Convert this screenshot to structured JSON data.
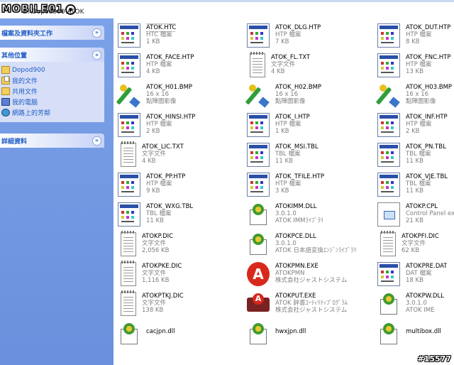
{
  "top": {
    "logo": "MOBILE01",
    "address": "D:\\Dopod900\\ATOK"
  },
  "panels": {
    "tasks": {
      "title": "檔案及資料夾工作"
    },
    "places": {
      "title": "其他位置",
      "items": [
        {
          "label": "Dopod900",
          "icon": "folder-icon"
        },
        {
          "label": "我的文件",
          "icon": "my-documents-icon"
        },
        {
          "label": "共用文件",
          "icon": "folder-icon"
        },
        {
          "label": "我的電腦",
          "icon": "my-computer-icon"
        },
        {
          "label": "網路上的芳鄰",
          "icon": "network-icon"
        }
      ]
    },
    "details": {
      "title": "詳細資料"
    }
  },
  "files": [
    {
      "name": "ATOK.HTC",
      "type": "HTC 檔案",
      "size": "1 KB",
      "icon": "htp"
    },
    {
      "name": "ATOK_DLG.HTP",
      "type": "HTP 檔案",
      "size": "7 KB",
      "icon": "htp"
    },
    {
      "name": "ATOK_DUT.HTP",
      "type": "HTP 檔案",
      "size": "8 KB",
      "icon": "htp"
    },
    {
      "name": "ATOK_FACE.HTP",
      "type": "HTP 檔案",
      "size": "4 KB",
      "icon": "htp"
    },
    {
      "name": "ATOK_FL.TXT",
      "type": "文字文件",
      "size": "4 KB",
      "icon": "txt"
    },
    {
      "name": "ATOK_FNC.HTP",
      "type": "HTP 檔案",
      "size": "13 KB",
      "icon": "htp"
    },
    {
      "name": "ATOK_H01.BMP",
      "type": "16 x 16",
      "size": "點陣圖影像",
      "icon": "bmp"
    },
    {
      "name": "ATOK_H02.BMP",
      "type": "16 x 16",
      "size": "點陣圖影像",
      "icon": "bmp"
    },
    {
      "name": "ATOK_H03.BMP",
      "type": "16 x 16",
      "size": "點陣圖影像",
      "icon": "bmp"
    },
    {
      "name": "ATOK_HINSI.HTP",
      "type": "HTP 檔案",
      "size": "2 KB",
      "icon": "htp"
    },
    {
      "name": "ATOK_I.HTP",
      "type": "HTP 檔案",
      "size": "1 KB",
      "icon": "htp"
    },
    {
      "name": "ATOK_INF.HTP",
      "type": "HTP 檔案",
      "size": "2 KB",
      "icon": "htp"
    },
    {
      "name": "ATOK_LIC.TXT",
      "type": "文字文件",
      "size": "4 KB",
      "icon": "txt"
    },
    {
      "name": "ATOK_MSI.TBL",
      "type": "TBL 檔案",
      "size": "11 KB",
      "icon": "htp"
    },
    {
      "name": "ATOK_PN.TBL",
      "type": "TBL 檔案",
      "size": "11 KB",
      "icon": "htp"
    },
    {
      "name": "ATOK_PP.HTP",
      "type": "HTP 檔案",
      "size": "9 KB",
      "icon": "htp"
    },
    {
      "name": "ATOK_TFILE.HTP",
      "type": "HTP 檔案",
      "size": "3 KB",
      "icon": "htp"
    },
    {
      "name": "ATOK_VJE.TBL",
      "type": "TBL 檔案",
      "size": "11 KB",
      "icon": "htp"
    },
    {
      "name": "ATOK_WXG.TBL",
      "type": "TBL 檔案",
      "size": "11 KB",
      "icon": "htp"
    },
    {
      "name": "ATOKIMM.DLL",
      "type": "3.0.1.0",
      "size": "ATOK IMMﾗｲﾌﾞﾗﾘ",
      "icon": "dll"
    },
    {
      "name": "ATOKP.CPL",
      "type": "Control Panel exte",
      "size": "21 KB",
      "icon": "cpl"
    },
    {
      "name": "ATOKP.DIC",
      "type": "文字文件",
      "size": "2,056 KB",
      "icon": "txt"
    },
    {
      "name": "ATOKPCE.DLL",
      "type": "3.0.1.0",
      "size": "ATOK 日本語変換ｴﾝｼﾞﾝﾗｲﾌﾞﾗﾘ",
      "icon": "dll"
    },
    {
      "name": "ATOKPFI.DIC",
      "type": "文字文件",
      "size": "62 KB",
      "icon": "txt"
    },
    {
      "name": "ATOKPKE.DIC",
      "type": "文字文件",
      "size": "1,116 KB",
      "icon": "txt"
    },
    {
      "name": "ATOKPMN.EXE",
      "type": "ATOKPMN",
      "size": "株式会社ジャストシステム",
      "icon": "exe"
    },
    {
      "name": "ATOKPRE.DAT",
      "type": "DAT 檔案",
      "size": "18 KB",
      "icon": "htp"
    },
    {
      "name": "ATOKPTKJ.DIC",
      "type": "文字文件",
      "size": "138 KB",
      "icon": "txt"
    },
    {
      "name": "ATOKPUT.EXE",
      "type": "ATOK 辞書ﾕｰﾃｨﾘﾃｨﾌﾟﾛｸﾞﾗﾑ",
      "size": "株式会社ジャストシステム",
      "icon": "exe2"
    },
    {
      "name": "ATOKPW.DLL",
      "type": "3.0.1.0",
      "size": "ATOK IME",
      "icon": "dll"
    },
    {
      "name": "cacjpn.dll",
      "type": "",
      "size": "",
      "icon": "dll"
    },
    {
      "name": "hwxjpn.dll",
      "type": "",
      "size": "",
      "icon": "dll"
    },
    {
      "name": "multibox.dll",
      "type": "",
      "size": "",
      "icon": "dll"
    }
  ],
  "watermark": "#15577"
}
